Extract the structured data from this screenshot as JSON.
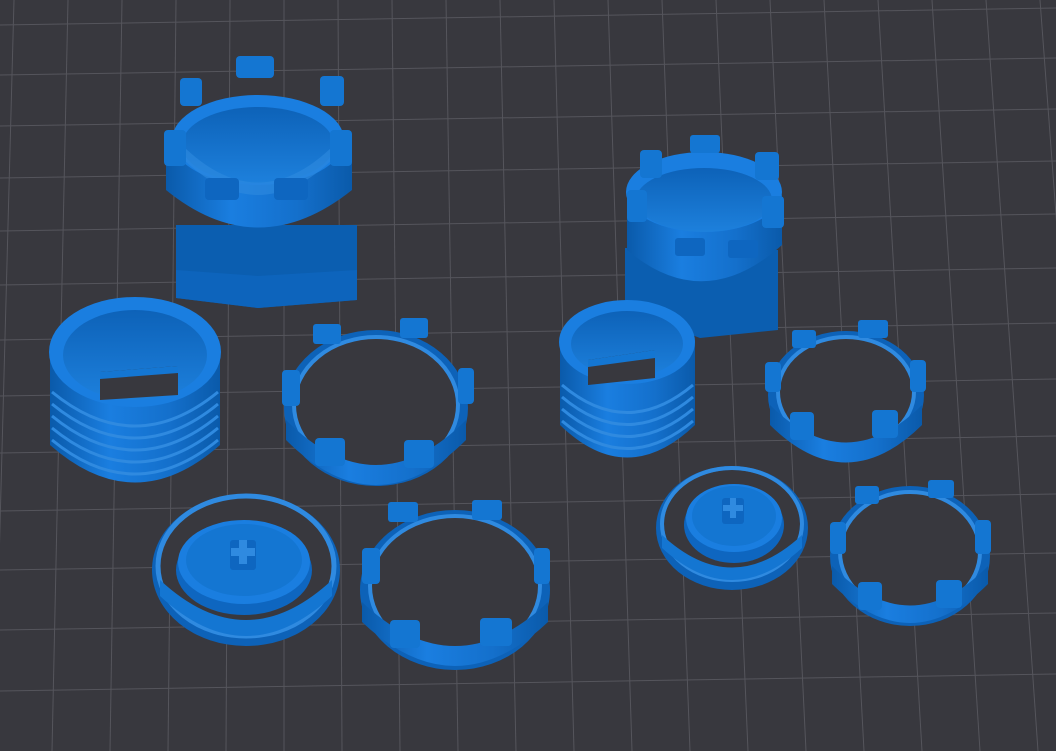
{
  "viewport": {
    "background": "#38383e",
    "grid_color": "#55555c",
    "model_color": "#1476d2",
    "model_color_dark": "#0a5aaa",
    "model_color_light": "#2f8ae0"
  },
  "parts": [
    {
      "name": "large-tower-holder"
    },
    {
      "name": "small-tower-holder"
    },
    {
      "name": "large-threaded-cup"
    },
    {
      "name": "large-castellated-ring-upper"
    },
    {
      "name": "small-threaded-cup"
    },
    {
      "name": "small-castellated-ring-upper"
    },
    {
      "name": "large-base-disc"
    },
    {
      "name": "large-castellated-ring-lower"
    },
    {
      "name": "small-base-disc"
    },
    {
      "name": "small-castellated-ring-lower"
    }
  ]
}
